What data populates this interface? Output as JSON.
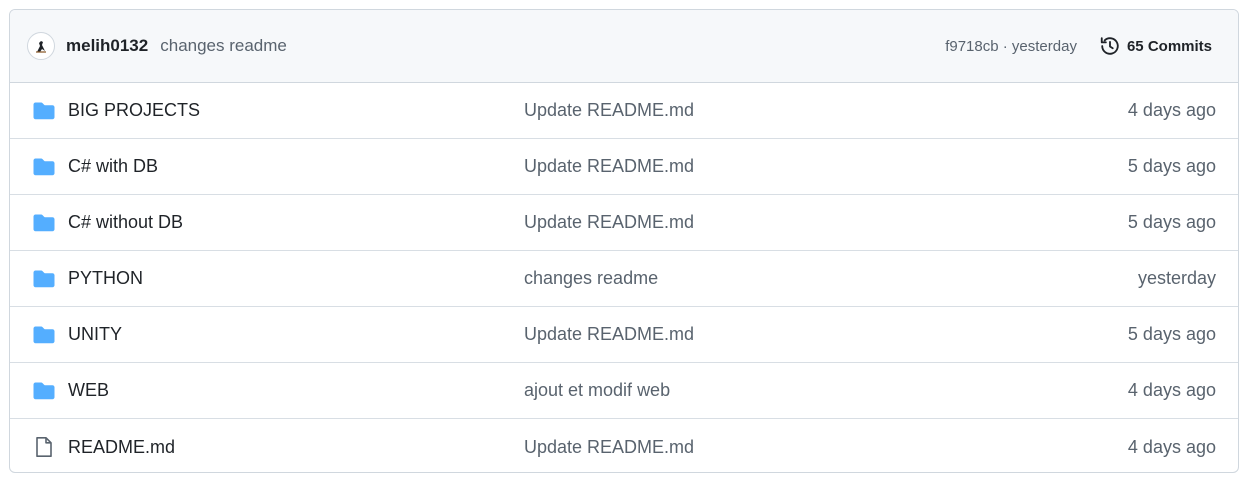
{
  "header": {
    "avatar_icon": "avatar-bird-icon",
    "author": "melih0132",
    "message": "changes readme",
    "commit_hash": "f9718cb",
    "separator": "·",
    "commit_time": "yesterday",
    "commits_icon": "history-icon",
    "commits_label": "65 Commits"
  },
  "colors": {
    "folder": "#54aeff",
    "file_icon": "#59636e",
    "border": "#d0d7de",
    "header_bg": "#f6f8fa"
  },
  "files": [
    {
      "type": "folder",
      "icon": "folder-icon",
      "name": "BIG PROJECTS",
      "commit": "Update README.md",
      "date": "4 days ago"
    },
    {
      "type": "folder",
      "icon": "folder-icon",
      "name": "C# with DB",
      "commit": "Update README.md",
      "date": "5 days ago"
    },
    {
      "type": "folder",
      "icon": "folder-icon",
      "name": "C# without DB",
      "commit": "Update README.md",
      "date": "5 days ago"
    },
    {
      "type": "folder",
      "icon": "folder-icon",
      "name": "PYTHON",
      "commit": "changes readme",
      "date": "yesterday"
    },
    {
      "type": "folder",
      "icon": "folder-icon",
      "name": "UNITY",
      "commit": "Update README.md",
      "date": "5 days ago"
    },
    {
      "type": "folder",
      "icon": "folder-icon",
      "name": "WEB",
      "commit": "ajout et modif web",
      "date": "4 days ago"
    },
    {
      "type": "file",
      "icon": "file-icon",
      "name": "README.md",
      "commit": "Update README.md",
      "date": "4 days ago"
    }
  ]
}
